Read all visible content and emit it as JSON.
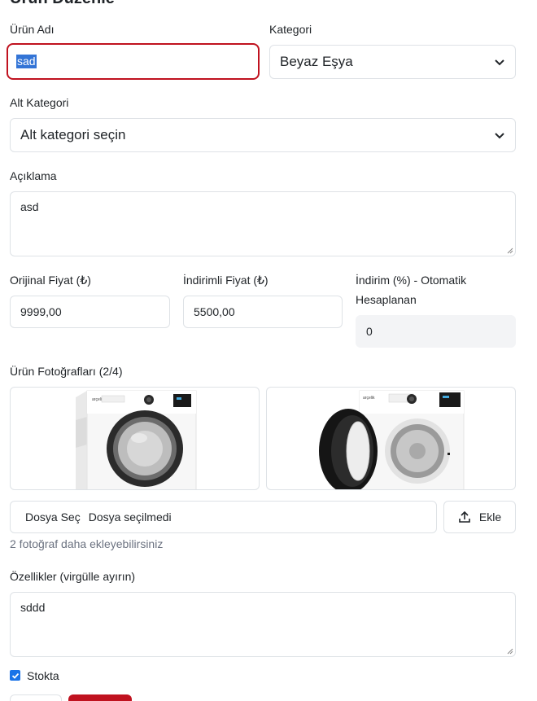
{
  "form": {
    "title": "Ürün Düzenle",
    "name_label": "Ürün Adı",
    "name_value": "sad",
    "category_label": "Kategori",
    "category_value": "Beyaz Eşya",
    "subcategory_label": "Alt Kategori",
    "subcategory_value": "Alt kategori seçin",
    "description_label": "Açıklama",
    "description_value": "asd",
    "original_price_label": "Orijinal Fiyat (₺)",
    "original_price_value": "9999,00",
    "discounted_price_label": "İndirimli Fiyat (₺)",
    "discounted_price_value": "5500,00",
    "discount_label": "İndirim (%) - Otomatik Hesaplanan",
    "discount_value": "0",
    "photos_label": "Ürün Fotoğrafları (2/4)",
    "file_button": "Dosya Seç",
    "file_status": "Dosya seçilmedi",
    "add_button": "Ekle",
    "photos_hint": "2 fotoğraf daha ekleyebilirsiniz",
    "features_label": "Özellikler (virgülle ayırın)",
    "features_value": "sddd",
    "in_stock_label": "Stokta",
    "in_stock_checked": true
  },
  "colors": {
    "accent_red": "#c0121f",
    "checkbox_blue": "#1a73e8"
  },
  "icons": {
    "upload": "upload-icon",
    "chevron": "chevron-down-icon"
  }
}
